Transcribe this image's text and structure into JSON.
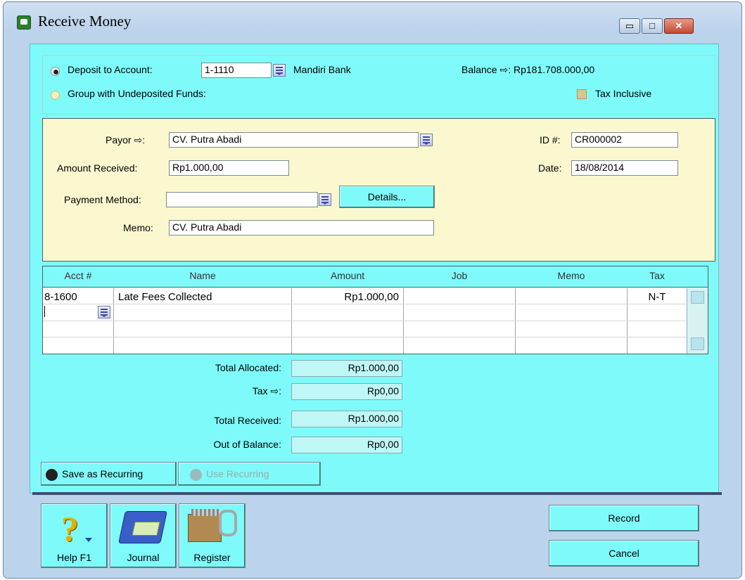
{
  "window": {
    "title": "Receive Money",
    "controls": {
      "minimize": "▭",
      "maximize": "□",
      "close": "✕"
    }
  },
  "deposit": {
    "deposit_label": "Deposit to Account:",
    "account_number": "1-1110",
    "account_name": "Mandiri Bank",
    "group_label": "Group with Undeposited Funds:",
    "balance_label": "Balance ⇨: Rp181.708.000,00",
    "tax_inclusive_label": "Tax Inclusive"
  },
  "header": {
    "payor_label": "Payor ⇨:",
    "payor_value": "CV. Putra Abadi",
    "amount_label": "Amount Received:",
    "amount_value": "Rp1.000,00",
    "payment_method_label": "Payment Method:",
    "payment_method_value": "",
    "details_button": "Details...",
    "memo_label": "Memo:",
    "memo_value": "CV. Putra Abadi",
    "id_label": "ID #:",
    "id_value": "CR000002",
    "date_label": "Date:",
    "date_value": "18/08/2014"
  },
  "grid": {
    "columns": [
      "Acct #",
      "Name",
      "Amount",
      "Job",
      "Memo",
      "Tax"
    ],
    "rows": [
      {
        "acct": "8-1600",
        "name": "Late Fees Collected",
        "amount": "Rp1.000,00",
        "job": "",
        "memo": "",
        "tax": "N-T"
      }
    ]
  },
  "totals": {
    "allocated_label": "Total Allocated:",
    "allocated_value": "Rp1.000,00",
    "tax_label": "Tax ⇨:",
    "tax_value": "Rp0,00",
    "received_label": "Total Received:",
    "received_value": "Rp1.000,00",
    "out_of_balance_label": "Out of Balance:",
    "out_of_balance_value": "Rp0,00"
  },
  "recurring": {
    "save_label": "Save as Recurring",
    "use_label": "Use Recurring"
  },
  "toolbar": {
    "help_label": "Help F1",
    "journal_label": "Journal",
    "register_label": "Register",
    "record_label": "Record",
    "cancel_label": "Cancel"
  },
  "colors": {
    "panel": "#7ffafa",
    "header_panel": "#fbf8d0",
    "title_bar": "#bcd3ec"
  }
}
